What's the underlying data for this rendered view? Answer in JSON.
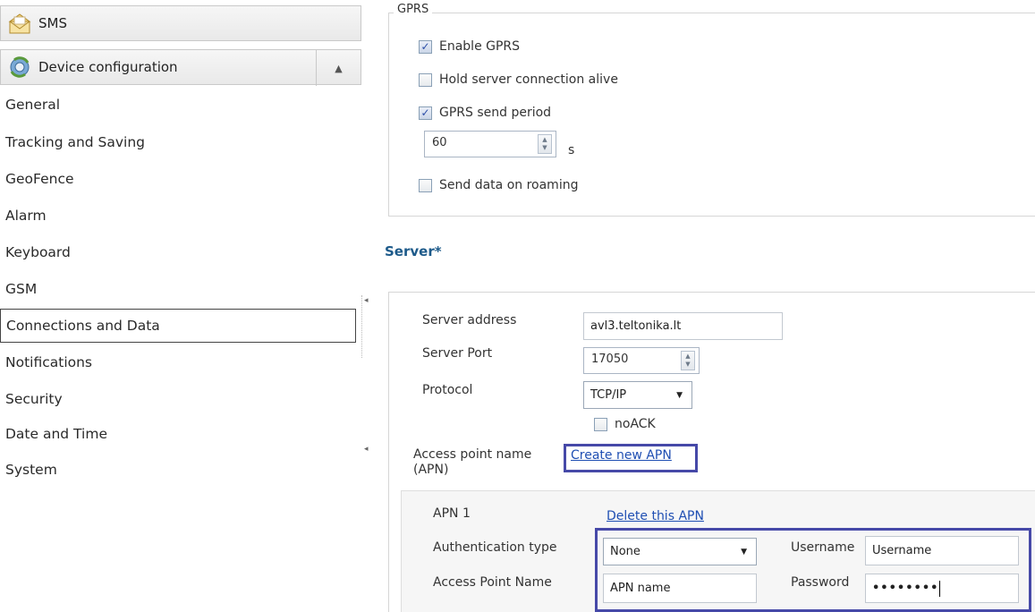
{
  "sidebar": {
    "sms": {
      "label": "SMS",
      "icon": "envelope-icon"
    },
    "device_config": {
      "label": "Device configuration",
      "icon": "gears-icon"
    },
    "items": [
      {
        "label": "General"
      },
      {
        "label": "Tracking and Saving"
      },
      {
        "label": "GeoFence"
      },
      {
        "label": "Alarm"
      },
      {
        "label": "Keyboard"
      },
      {
        "label": "GSM"
      },
      {
        "label": "Connections and Data",
        "selected": true
      },
      {
        "label": "Notifications"
      },
      {
        "label": "Security"
      },
      {
        "label": "Date and Time"
      },
      {
        "label": "System"
      }
    ]
  },
  "gprs": {
    "group_title": "GPRS",
    "enable_gprs": {
      "label": "Enable GPRS",
      "checked": true
    },
    "hold_alive": {
      "label": "Hold server connection alive",
      "checked": false
    },
    "send_period": {
      "label": "GPRS send period",
      "checked": true,
      "value": "60",
      "unit": "s"
    },
    "roaming": {
      "label": "Send data on roaming",
      "checked": false
    }
  },
  "server": {
    "title": "Server*",
    "address_label": "Server address",
    "address_value": "avl3.teltonika.lt",
    "port_label": "Server Port",
    "port_value": "17050",
    "protocol_label": "Protocol",
    "protocol_value": "TCP/IP",
    "noack": {
      "label": "noACK",
      "checked": false
    },
    "apn_label_line1": "Access point name",
    "apn_label_line2": "(APN)",
    "create_apn": "Create new APN"
  },
  "apn1": {
    "title": "APN 1",
    "delete_link": "Delete this APN",
    "auth_label": "Authentication type",
    "auth_value": "None",
    "apn_name_label": "Access Point Name",
    "apn_name_value": "APN name",
    "username_label": "Username",
    "username_value": "Username",
    "password_label": "Password",
    "password_value": "••••••••"
  },
  "colors": {
    "highlight": "#4649a8",
    "section_title": "#1d5a8a",
    "link": "#1f4fb3"
  }
}
